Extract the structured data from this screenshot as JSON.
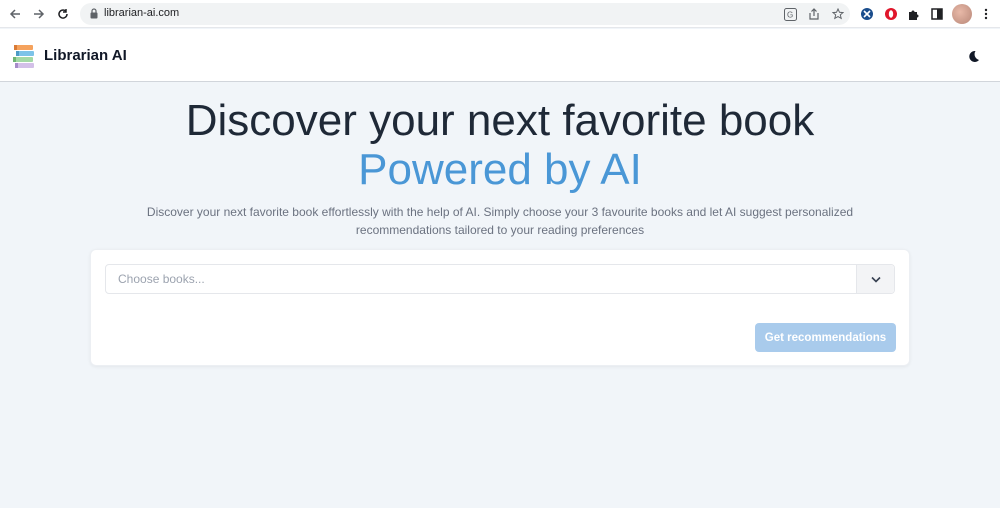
{
  "browser": {
    "url": "librarian-ai.com",
    "icons": [
      "back-icon",
      "forward-icon",
      "reload-icon",
      "lock-icon",
      "translate-icon",
      "share-icon",
      "bookmark-star-icon",
      "extension-icon",
      "extension-opera-icon",
      "puzzle-icon",
      "sidebar-icon",
      "profile-avatar",
      "more-menu-icon"
    ]
  },
  "header": {
    "brand": "Librarian AI",
    "theme_icon": "moon-icon"
  },
  "hero": {
    "title": "Discover your next favorite book",
    "subtitle": "Powered by AI",
    "description": "Discover your next favorite book effortlessly with the help of AI. Simply choose your 3 favourite books and let AI suggest personalized recommendations tailored to your reading preferences"
  },
  "form": {
    "placeholder": "Choose books...",
    "value": "",
    "button_label": "Get recommendations"
  },
  "colors": {
    "accent": "#4a97d6",
    "button_disabled": "#a9cbec",
    "background": "#f1f5f9"
  }
}
